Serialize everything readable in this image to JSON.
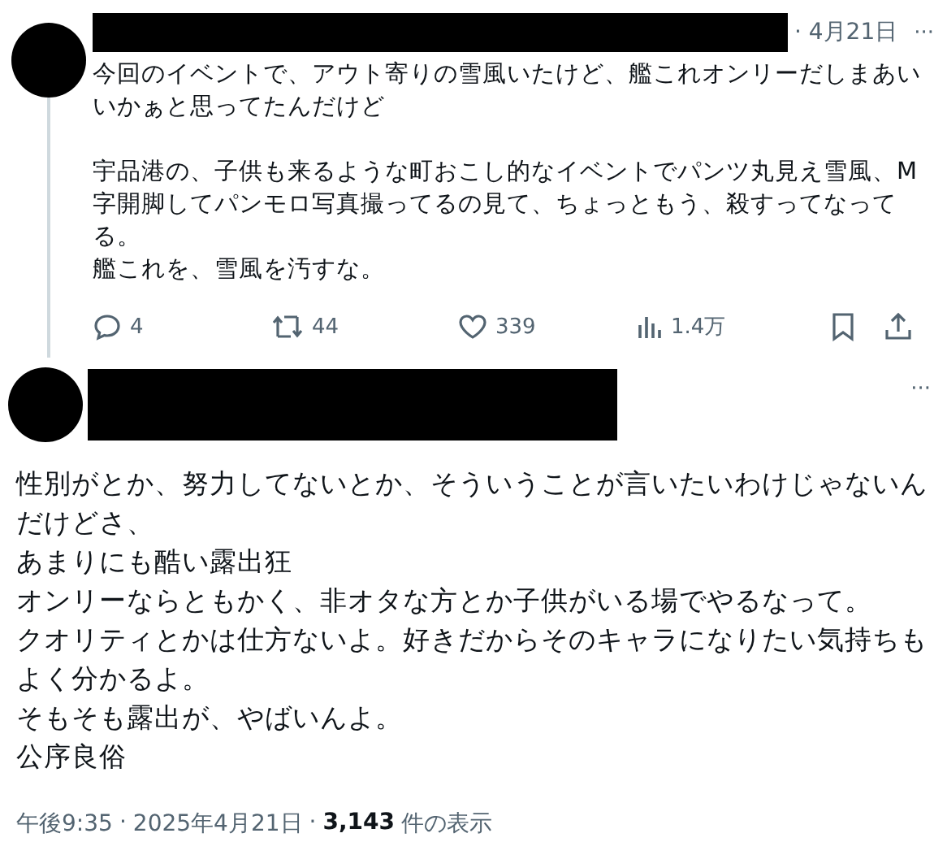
{
  "reply_post": {
    "date": "· 4月21日",
    "more": "···",
    "paragraphs": [
      [
        "今回のイベントで、アウト寄りの雪風いたけど、艦これオンリーだしまあい",
        "いかぁと思ってたんだけど"
      ],
      [
        "宇品港の、子供も来るような町おこし的なイベントでパンツ丸見え雪風、M",
        "字開脚してパンモロ写真撮ってるの見て、ちょっともう、殺すってなって",
        "る。",
        "艦これを、雪風を汚すな。"
      ]
    ],
    "actions": [
      {
        "kind": "reply",
        "count": "4"
      },
      {
        "kind": "repost",
        "count": "44"
      },
      {
        "kind": "like",
        "count": "339"
      },
      {
        "kind": "views",
        "count": "1.4万"
      },
      {
        "kind": "bookmark"
      },
      {
        "kind": "share"
      }
    ]
  },
  "main_post": {
    "more": "···",
    "lines": [
      "性別がとか、努力してないとか、そういうことが言いたいわけじゃないん",
      "だけどさ、",
      "あまりにも酷い露出狂",
      "オンリーならともかく、非オタな方とか子供がいる場でやるなって。",
      "クオリティとかは仕方ないよ。好きだからそのキャラになりたい気持ちも",
      "よく分かるよ。",
      "そもそも露出が、やばいんよ。",
      "公序良俗"
    ],
    "time": "午後9:35",
    "dot": "·",
    "date": "2025年4月21日",
    "dot2": "·",
    "views": "3,143",
    "views_label": "件の表示"
  }
}
